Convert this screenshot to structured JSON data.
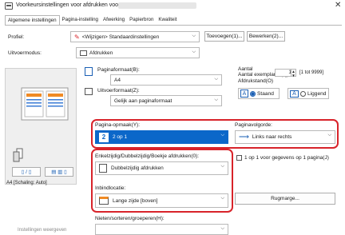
{
  "window": {
    "title": "Voorkeursinstellingen voor afdrukken voor",
    "printer_name_hidden": true
  },
  "tabs": [
    {
      "label": "Algemene instellingen",
      "active": true
    },
    {
      "label": "Pagina-instelling",
      "active": false
    },
    {
      "label": "Afwerking",
      "active": false
    },
    {
      "label": "Papierbron",
      "active": false
    },
    {
      "label": "Kwaliteit",
      "active": false
    }
  ],
  "profile": {
    "label": "Profiel:",
    "value": "<Wijzigen> Standaardinstellingen",
    "add_button": "Toevoegen(1)...",
    "edit_button": "Bewerken(2)..."
  },
  "output_mode": {
    "label": "Uitvoermodus:",
    "value": "Afdrukken"
  },
  "page_format": {
    "label": "Paginaformaat(B):",
    "value": "A4"
  },
  "output_format": {
    "label": "Uitvoerformaat(Z):",
    "value": "Gelijk aan paginaformaat"
  },
  "copies": {
    "label": "Aantal exemplaren(Q):",
    "value": "1",
    "range": "[1 tot 9999]"
  },
  "orientation": {
    "label": "Afdrukstand(O)",
    "option1": "Staand",
    "option2": "Liggend",
    "selected": "Staand",
    "icon_letter": "A"
  },
  "preview": {
    "caption": "A4 [Schaling: Auto]",
    "bottom_link": "Instellingen weergeven"
  },
  "page_layout": {
    "label": "Pagina-opmaak(Y):",
    "value": "2 op 1",
    "icon_number": "2"
  },
  "page_order": {
    "label": "Paginavolgorde:",
    "value": "Links naar rechts"
  },
  "duplex": {
    "label": "Enkelzijdig/Dubbelzijdig/Boekje afdrukken(0):",
    "value": "Dubbelzijdig afdrukken"
  },
  "one_per_page": {
    "label": "1 op 1 voor gegevens op 1 pagina(J)",
    "checked": false
  },
  "binding": {
    "label": "Inbindlocatie:",
    "value": "Lange zijde [boven]"
  },
  "margin_button": "Rugmarge...",
  "staple": {
    "label": "Nieten/sorteren/groeperen(H):"
  },
  "colors": {
    "accent": "#0b67c9",
    "highlight": "#d8232a"
  }
}
